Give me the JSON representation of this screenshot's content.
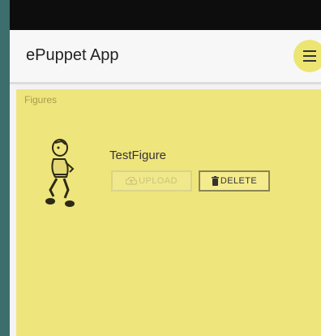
{
  "app": {
    "title": "ePuppet App",
    "accent_color": "#ece572",
    "content_bg": "#efe57d"
  },
  "toolbar": {
    "menu_icon": "hamburger-menu-icon"
  },
  "figures": {
    "section_label": "Figures",
    "items": [
      {
        "name": "TestFigure",
        "thumbnail": "puppet-figure-image",
        "upload_label": "UPLOAD",
        "upload_icon": "cloud-upload-icon",
        "upload_enabled": false,
        "delete_label": "DELETE",
        "delete_icon": "trash-icon"
      }
    ]
  }
}
